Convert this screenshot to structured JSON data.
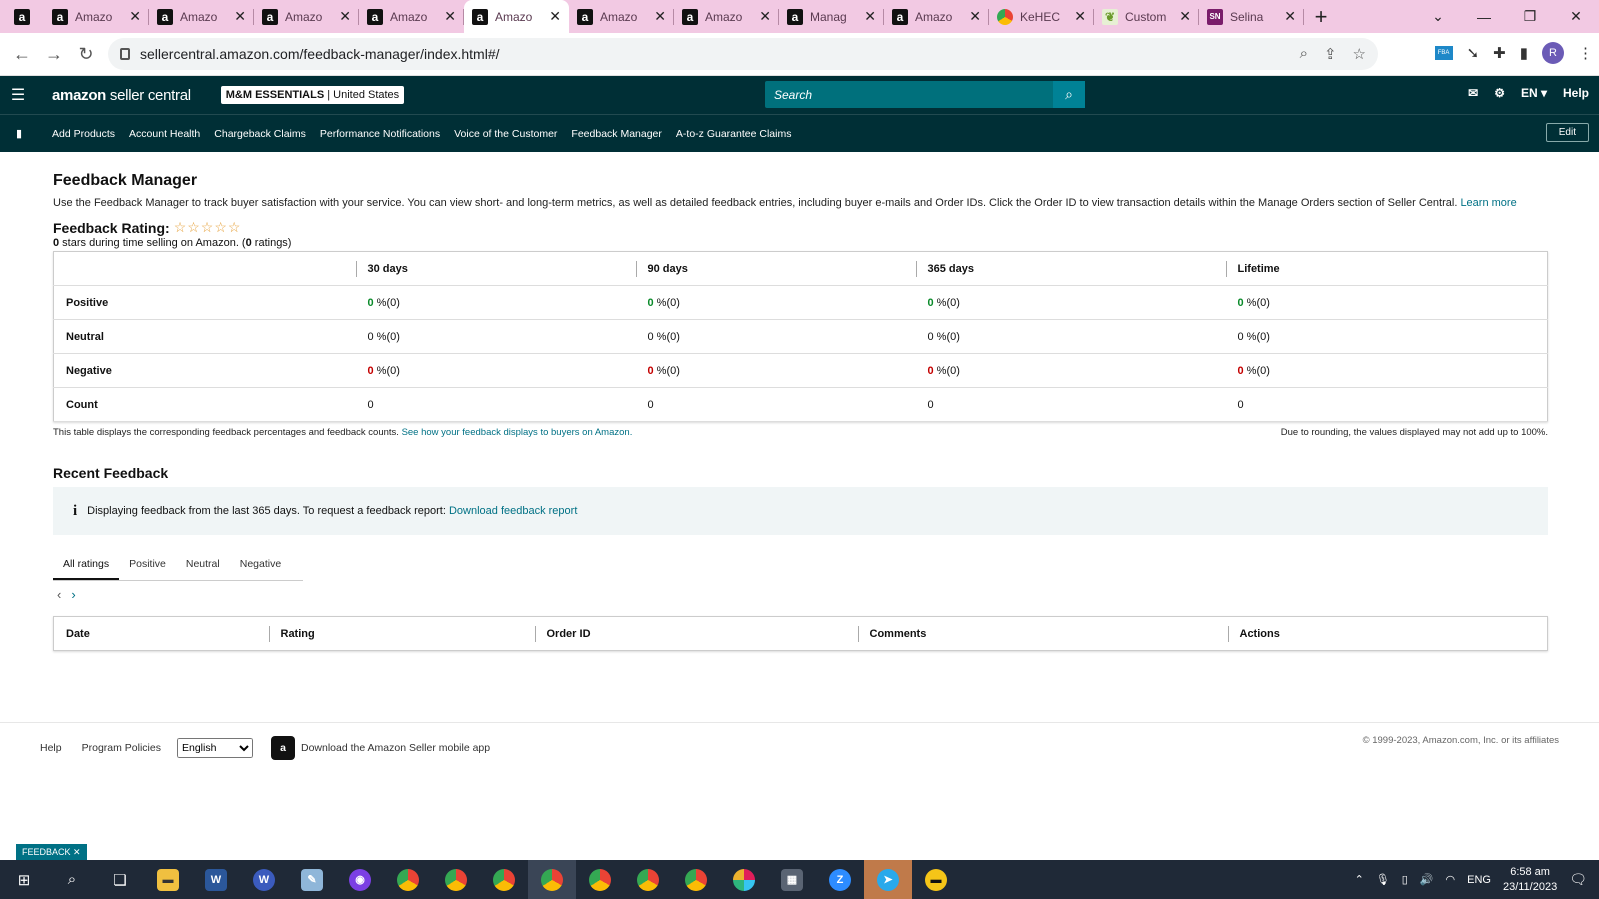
{
  "browser": {
    "tabs": [
      {
        "label": "Amazo",
        "icon": "amazon-icon",
        "active": false
      },
      {
        "label": "Amazo",
        "icon": "amazon-icon",
        "active": false
      },
      {
        "label": "Amazo",
        "icon": "amazon-icon",
        "active": false
      },
      {
        "label": "Amazo",
        "icon": "amazon-icon",
        "active": false
      },
      {
        "label": "Amazo",
        "icon": "amazon-icon",
        "active": true
      },
      {
        "label": "Amazo",
        "icon": "amazon-icon",
        "active": false
      },
      {
        "label": "Amazo",
        "icon": "amazon-icon",
        "active": false
      },
      {
        "label": "Manag",
        "icon": "amazon-icon",
        "active": false
      },
      {
        "label": "Amazo",
        "icon": "amazon-icon",
        "active": false
      },
      {
        "label": "KeHEC",
        "icon": "chrome-icon",
        "active": false
      },
      {
        "label": "Custom",
        "icon": "leaf-icon",
        "active": false
      },
      {
        "label": "Selina",
        "icon": "sn-icon",
        "active": false
      }
    ],
    "url": "sellercentral.amazon.com/feedback-manager/index.html#/",
    "profile_initial": "R"
  },
  "header": {
    "logo_bold": "amazon",
    "logo_light": " seller central",
    "store_name": "M&M ESSENTIALS",
    "store_region": " | United States",
    "search_placeholder": "Search",
    "language": "EN",
    "help": "Help"
  },
  "nav": {
    "links": [
      "Add Products",
      "Account Health",
      "Chargeback Claims",
      "Performance Notifications",
      "Voice of the Customer",
      "Feedback Manager",
      "A-to-z Guarantee Claims"
    ],
    "edit": "Edit"
  },
  "page": {
    "title": "Feedback Manager",
    "description": "Use the Feedback Manager to track buyer satisfaction with your service. You can view short- and long-term metrics, as well as detailed feedback entries, including buyer e-mails and Order IDs. Click the Order ID to view transaction details within the Manage Orders section of Seller Central.",
    "learn_more": "Learn more",
    "rating_title": "Feedback Rating:",
    "stars": "☆☆☆☆☆",
    "rating_stars_value": "0",
    "rating_sub_mid": " stars during time selling on Amazon. (",
    "rating_count": "0",
    "rating_sub_end": " ratings)"
  },
  "feedback_table": {
    "columns": [
      "30 days",
      "90 days",
      "365 days",
      "Lifetime"
    ],
    "rows": [
      {
        "label": "Positive",
        "cells": [
          {
            "num": "0",
            "pct": " %(0)"
          },
          {
            "num": "0",
            "pct": " %(0)"
          },
          {
            "num": "0",
            "pct": " %(0)"
          },
          {
            "num": "0",
            "pct": " %(0)"
          }
        ]
      },
      {
        "label": "Neutral",
        "cells": [
          {
            "num": "0",
            "pct": " %(0)"
          },
          {
            "num": "0",
            "pct": " %(0)"
          },
          {
            "num": "0",
            "pct": " %(0)"
          },
          {
            "num": "0",
            "pct": " %(0)"
          }
        ]
      },
      {
        "label": "Negative",
        "cells": [
          {
            "num": "0",
            "pct": " %(0)"
          },
          {
            "num": "0",
            "pct": " %(0)"
          },
          {
            "num": "0",
            "pct": " %(0)"
          },
          {
            "num": "0",
            "pct": " %(0)"
          }
        ]
      },
      {
        "label": "Count",
        "cells": [
          {
            "num": "0",
            "pct": ""
          },
          {
            "num": "0",
            "pct": ""
          },
          {
            "num": "0",
            "pct": ""
          },
          {
            "num": "0",
            "pct": ""
          }
        ]
      }
    ],
    "footnote": "This table displays the corresponding feedback percentages and feedback counts.",
    "footnote_link": "See how your feedback displays to buyers on Amazon.",
    "rounding_note": "Due to rounding, the values displayed may not add up to 100%."
  },
  "recent": {
    "title": "Recent Feedback",
    "info_text": "Displaying feedback from the last 365 days. To request a feedback report:",
    "info_link": "Download feedback report",
    "filter_tabs": [
      "All ratings",
      "Positive",
      "Neutral",
      "Negative"
    ],
    "columns": [
      "Date",
      "Rating",
      "Order ID",
      "Comments",
      "Actions"
    ]
  },
  "footer": {
    "help": "Help",
    "policies": "Program Policies",
    "language_selected": "English",
    "app_link": "Download the Amazon Seller mobile app",
    "copyright": "© 1999-2023, Amazon.com, Inc. or its affiliates",
    "feedback_tag": "FEEDBACK ✕"
  },
  "taskbar": {
    "input_lang": "ENG",
    "time": "6:58 am",
    "date": "23/11/2023"
  }
}
